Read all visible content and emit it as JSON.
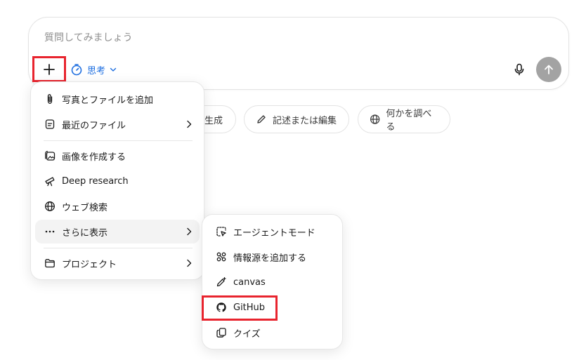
{
  "composer": {
    "placeholder": "質問してみましょう",
    "think_label": "思考"
  },
  "chips": [
    {
      "label": "生成",
      "icon": "image-icon"
    },
    {
      "label": "記述または編集",
      "icon": "pencil-icon"
    },
    {
      "label": "何かを調べる",
      "icon": "globe-icon"
    }
  ],
  "menu": {
    "items": [
      {
        "label": "写真とファイルを追加",
        "icon": "paperclip-icon"
      },
      {
        "label": "最近のファイル",
        "icon": "file-icon"
      },
      {
        "label": "画像を作成する",
        "icon": "image-create-icon"
      },
      {
        "label": "Deep research",
        "icon": "telescope-icon"
      },
      {
        "label": "ウェブ検索",
        "icon": "globe-icon"
      },
      {
        "label": "さらに表示",
        "icon": "more-dots-icon"
      },
      {
        "label": "プロジェクト",
        "icon": "folder-icon"
      }
    ]
  },
  "submenu": {
    "items": [
      {
        "label": "エージェントモード",
        "icon": "agent-cursor-icon"
      },
      {
        "label": "情報源を追加する",
        "icon": "connectors-icon"
      },
      {
        "label": "canvas",
        "icon": "canvas-pen-icon"
      },
      {
        "label": "GitHub",
        "icon": "github-icon"
      },
      {
        "label": "クイズ",
        "icon": "quiz-cards-icon"
      }
    ]
  },
  "colors": {
    "accent_blue": "#1f6fe0",
    "highlight_red": "#e8242e",
    "send_button_gray": "#a3a3a3"
  }
}
